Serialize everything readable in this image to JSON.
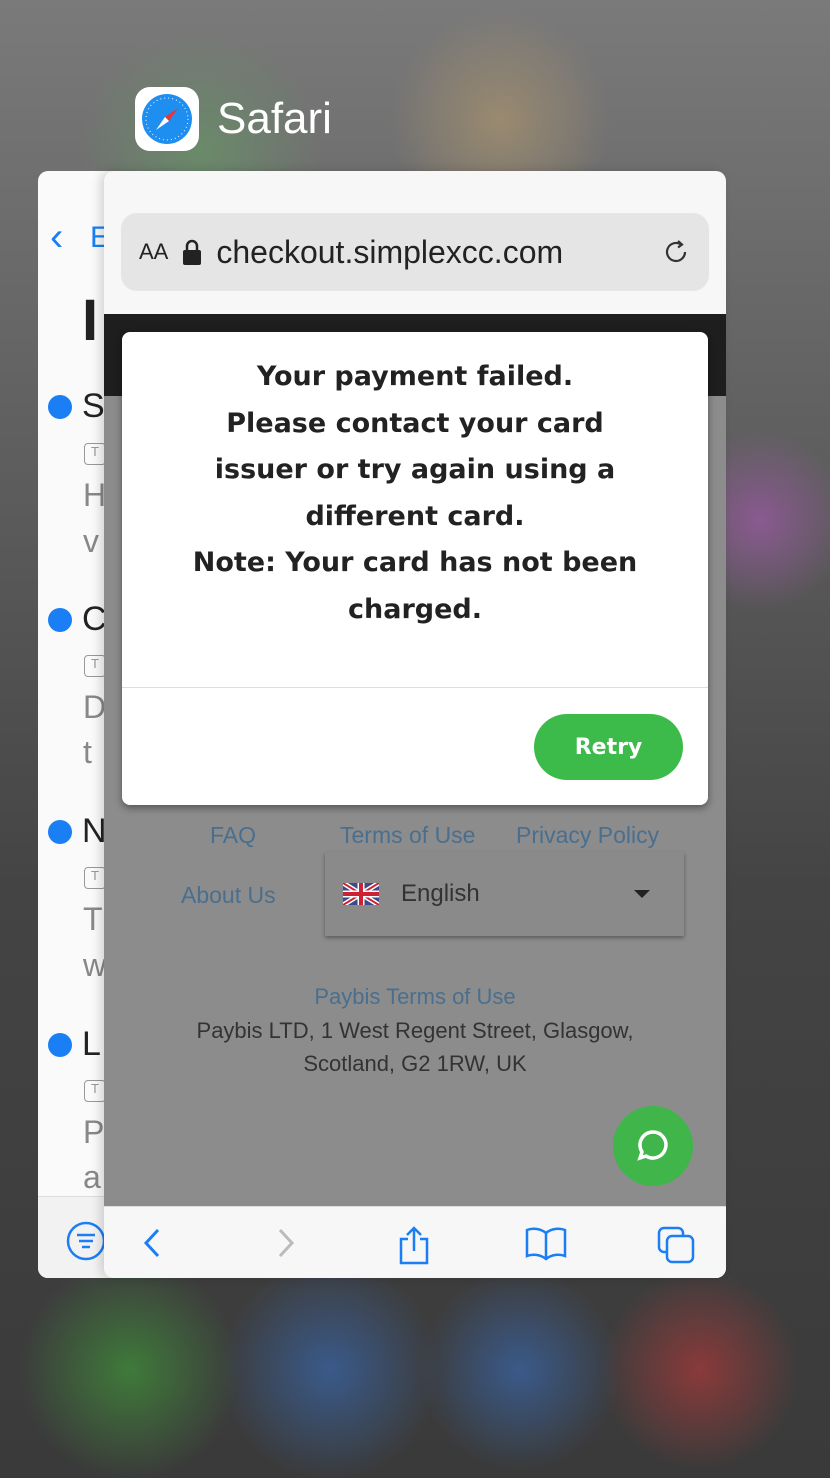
{
  "app_switcher": {
    "app_title": "Safari",
    "app_icon": "safari-compass-icon"
  },
  "mail_card": {
    "back_fragment": "E",
    "title_fragment": "I",
    "items": [
      {
        "initial": "S",
        "line1": "H",
        "line2": "v"
      },
      {
        "initial": "C",
        "line1": "D",
        "line2": "t"
      },
      {
        "initial": "N",
        "line1": "T",
        "line2": "w"
      },
      {
        "initial": "L",
        "line1": "P",
        "line2": "a"
      }
    ],
    "tag_label": "T",
    "unread_color": "#1a7ef5"
  },
  "safari": {
    "text_size_label": "AA",
    "url": "checkout.simplexcc.com"
  },
  "modal": {
    "lines": [
      "Your payment failed.",
      "Please contact your card",
      "issuer or try again using a",
      "different card.",
      "Note: Your card has not been",
      "charged."
    ],
    "retry_label": "Retry",
    "accent": "#3dbb4a"
  },
  "footer": {
    "faq": "FAQ",
    "terms": "Terms of Use",
    "privacy": "Privacy Policy",
    "about": "About Us",
    "language": "English",
    "paybis_terms": "Paybis Terms of Use",
    "address_line1": "Paybis LTD, 1 West Regent Street, Glasgow,",
    "address_line2": "Scotland, G2 1RW, UK"
  }
}
